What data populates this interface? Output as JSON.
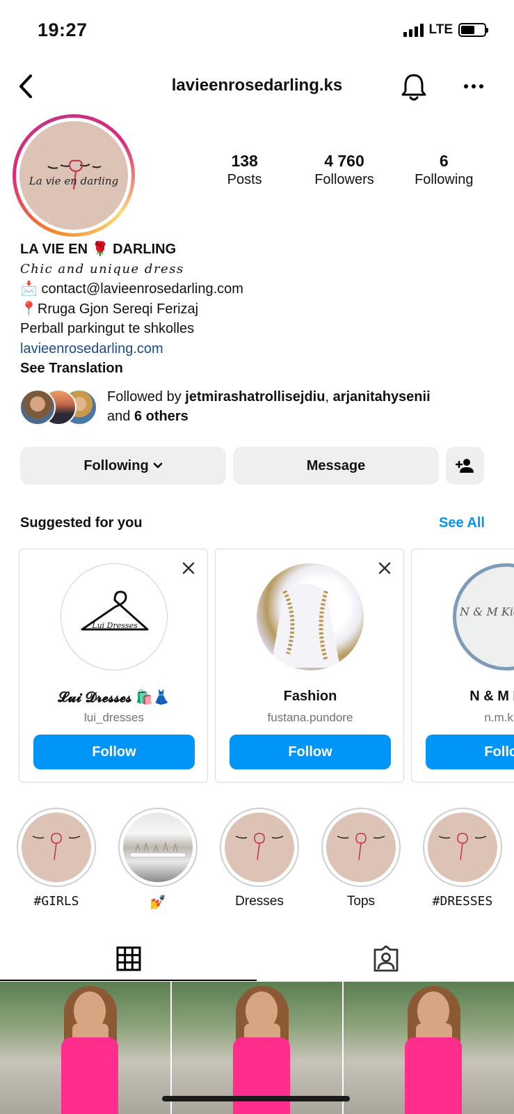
{
  "status_bar": {
    "time": "19:27",
    "network": "LTE"
  },
  "header": {
    "username": "lavieenrosedarling.ks"
  },
  "profile": {
    "avatar_text": "La vie en darling",
    "stats": [
      {
        "value": "138",
        "label": "Posts"
      },
      {
        "value": "4 760",
        "label": "Followers"
      },
      {
        "value": "6",
        "label": "Following"
      }
    ],
    "display_name": "LA VIE EN 🌹 DARLING",
    "tagline": "Chic and unique dress",
    "email_line": "📩 contact@lavieenrosedarling.com",
    "address_line1": "📍Rruga Gjon Sereqi Ferizaj",
    "address_line2": "Perball parkingut te shkolles",
    "website": "lavieenrosedarling.com",
    "see_translation": "See Translation"
  },
  "followed_by": {
    "prefix": "Followed by ",
    "user1": "jetmirashatrollisejdiu",
    "sep": ", ",
    "user2": "arjanitahysenii",
    "and": "and ",
    "others": "6 others"
  },
  "actions": {
    "following": "Following",
    "message": "Message"
  },
  "suggested": {
    "title": "Suggested for you",
    "see_all": "See All",
    "cards": [
      {
        "name": "𝓛𝓾𝓲 𝓓𝓻𝓮𝓼𝓼𝓮𝓼 🛍️👗",
        "handle": "lui_dresses",
        "follow": "Follow",
        "pic_text": "Lui Dresses"
      },
      {
        "name": "Fashion",
        "handle": "fustana.pundore",
        "follow": "Follow"
      },
      {
        "name": "N & M Kids",
        "handle": "n.m.kids",
        "follow": "Follow",
        "pic_text": "N & M Kids Clothing"
      }
    ]
  },
  "highlights": [
    {
      "label": "#GIRLS"
    },
    {
      "label": "💅"
    },
    {
      "label": "Dresses"
    },
    {
      "label": "Tops"
    },
    {
      "label": "#DRESSES"
    }
  ],
  "colors": {
    "accent": "#0095f6",
    "link": "#1b4b8a",
    "button_bg": "#efefef",
    "avatar_bg": "#dcc3b5",
    "dress": "#ff2e8c"
  }
}
